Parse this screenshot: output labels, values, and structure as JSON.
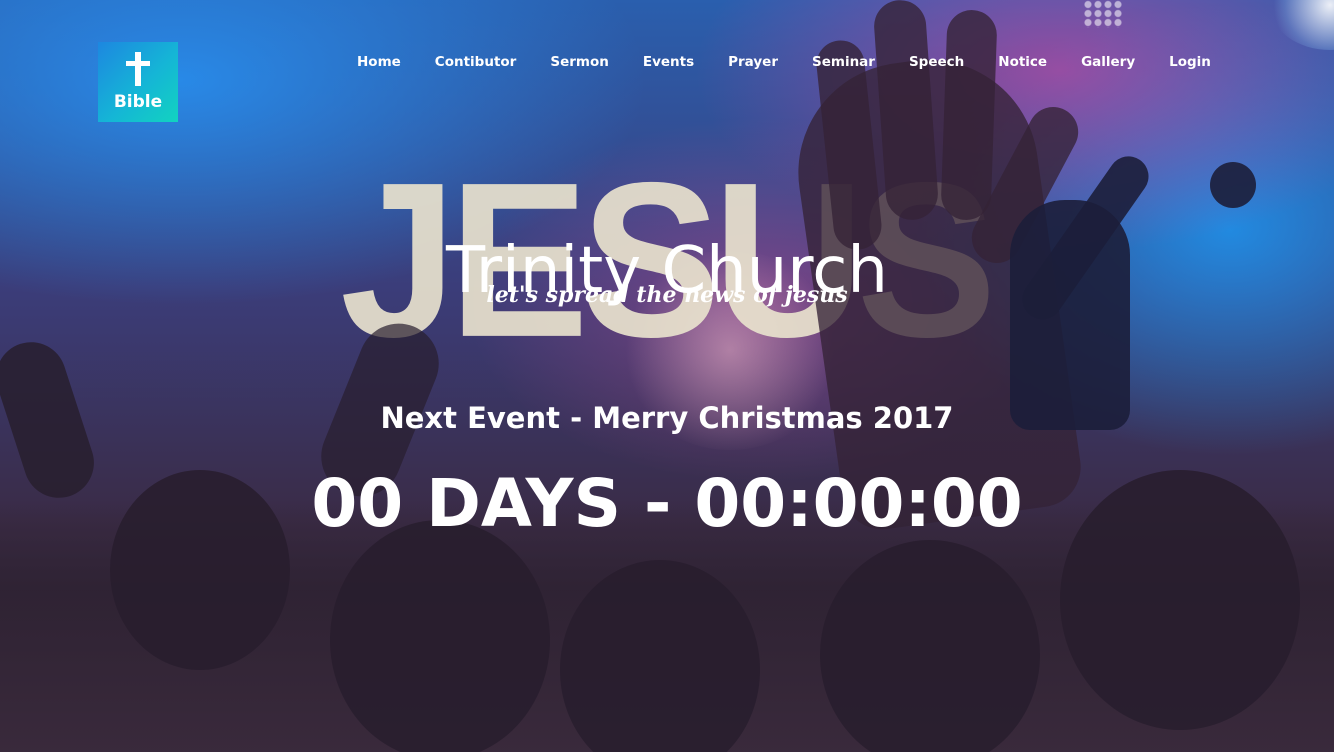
{
  "logo": {
    "label": "Bible",
    "icon": "cross-icon"
  },
  "nav": {
    "items": [
      {
        "label": "Home"
      },
      {
        "label": "Contibutor"
      },
      {
        "label": "Sermon"
      },
      {
        "label": "Events"
      },
      {
        "label": "Prayer"
      },
      {
        "label": "Seminar"
      },
      {
        "label": "Speech"
      },
      {
        "label": "Notice"
      },
      {
        "label": "Gallery"
      },
      {
        "label": "Login"
      }
    ]
  },
  "hero": {
    "background_text": "JESUS",
    "title": "Trinity Church",
    "tagline": "let's spread the news of jesus",
    "next_event": "Next Event - Merry Christmas 2017",
    "countdown": "00 DAYS - 00:00:00"
  },
  "colors": {
    "logo_gradient_start": "#1d87e0",
    "logo_gradient_end": "#12d3c0",
    "text": "#ffffff"
  }
}
